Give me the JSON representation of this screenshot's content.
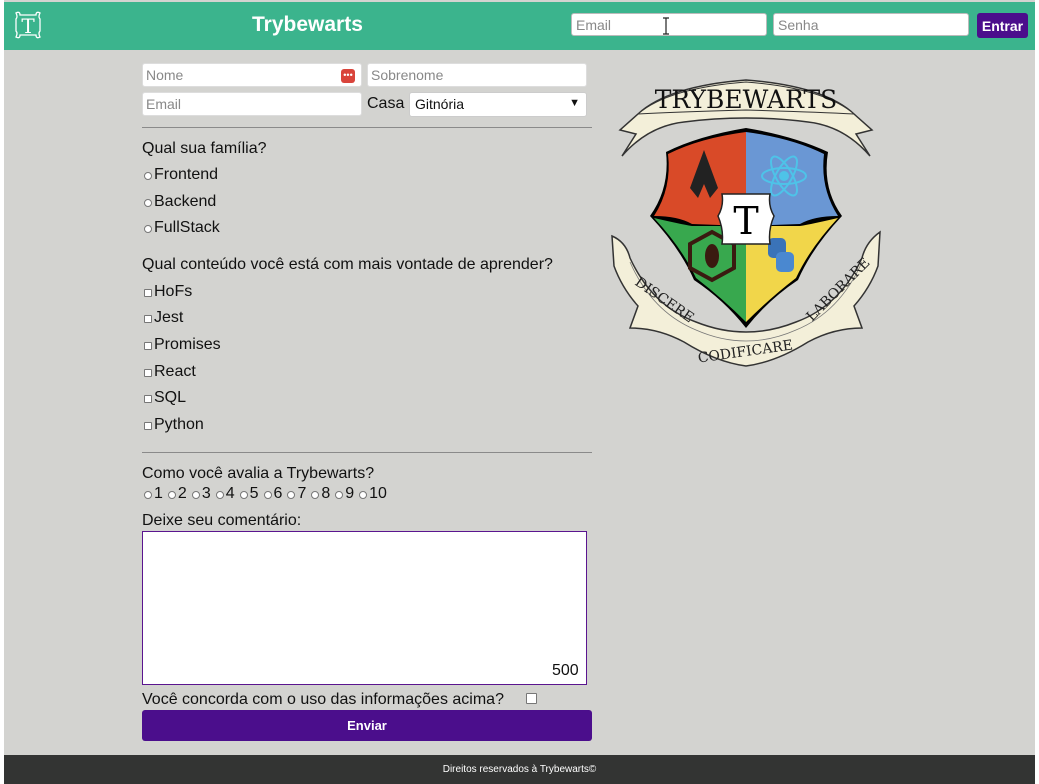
{
  "header": {
    "title": "Trybewarts",
    "logo_letter": "T",
    "email_placeholder": "Email",
    "password_placeholder": "Senha",
    "login_label": "Entrar"
  },
  "form": {
    "name_placeholder": "Nome",
    "lastname_placeholder": "Sobrenome",
    "email_placeholder": "Email",
    "house_label": "Casa",
    "house_selected": "Gitnória",
    "family_question": "Qual sua família?",
    "families": [
      "Frontend",
      "Backend",
      "FullStack"
    ],
    "content_question": "Qual conteúdo você está com mais vontade de aprender?",
    "contents": [
      "HoFs",
      "Jest",
      "Promises",
      "React",
      "SQL",
      "Python"
    ],
    "rate_question": "Como você avalia a Trybewarts?",
    "rates": [
      "1",
      "2",
      "3",
      "4",
      "5",
      "6",
      "7",
      "8",
      "9",
      "10"
    ],
    "comment_label": "Deixe seu comentário:",
    "counter": "500",
    "agreement_label": "Você concorda com o uso das informações acima?",
    "submit_label": "Enviar"
  },
  "crest": {
    "banner_text": "TRYBEWARTS",
    "center_letter": "T",
    "motto_left": "DISCERE",
    "motto_bottom": "CODIFICARE",
    "motto_right": "LABORARE"
  },
  "footer": {
    "text": "Direitos reservados à Trybewarts©"
  },
  "colors": {
    "header": "#3bb48d",
    "accent": "#4b0e8c",
    "background": "#d3d3d0",
    "footer": "#333433"
  }
}
